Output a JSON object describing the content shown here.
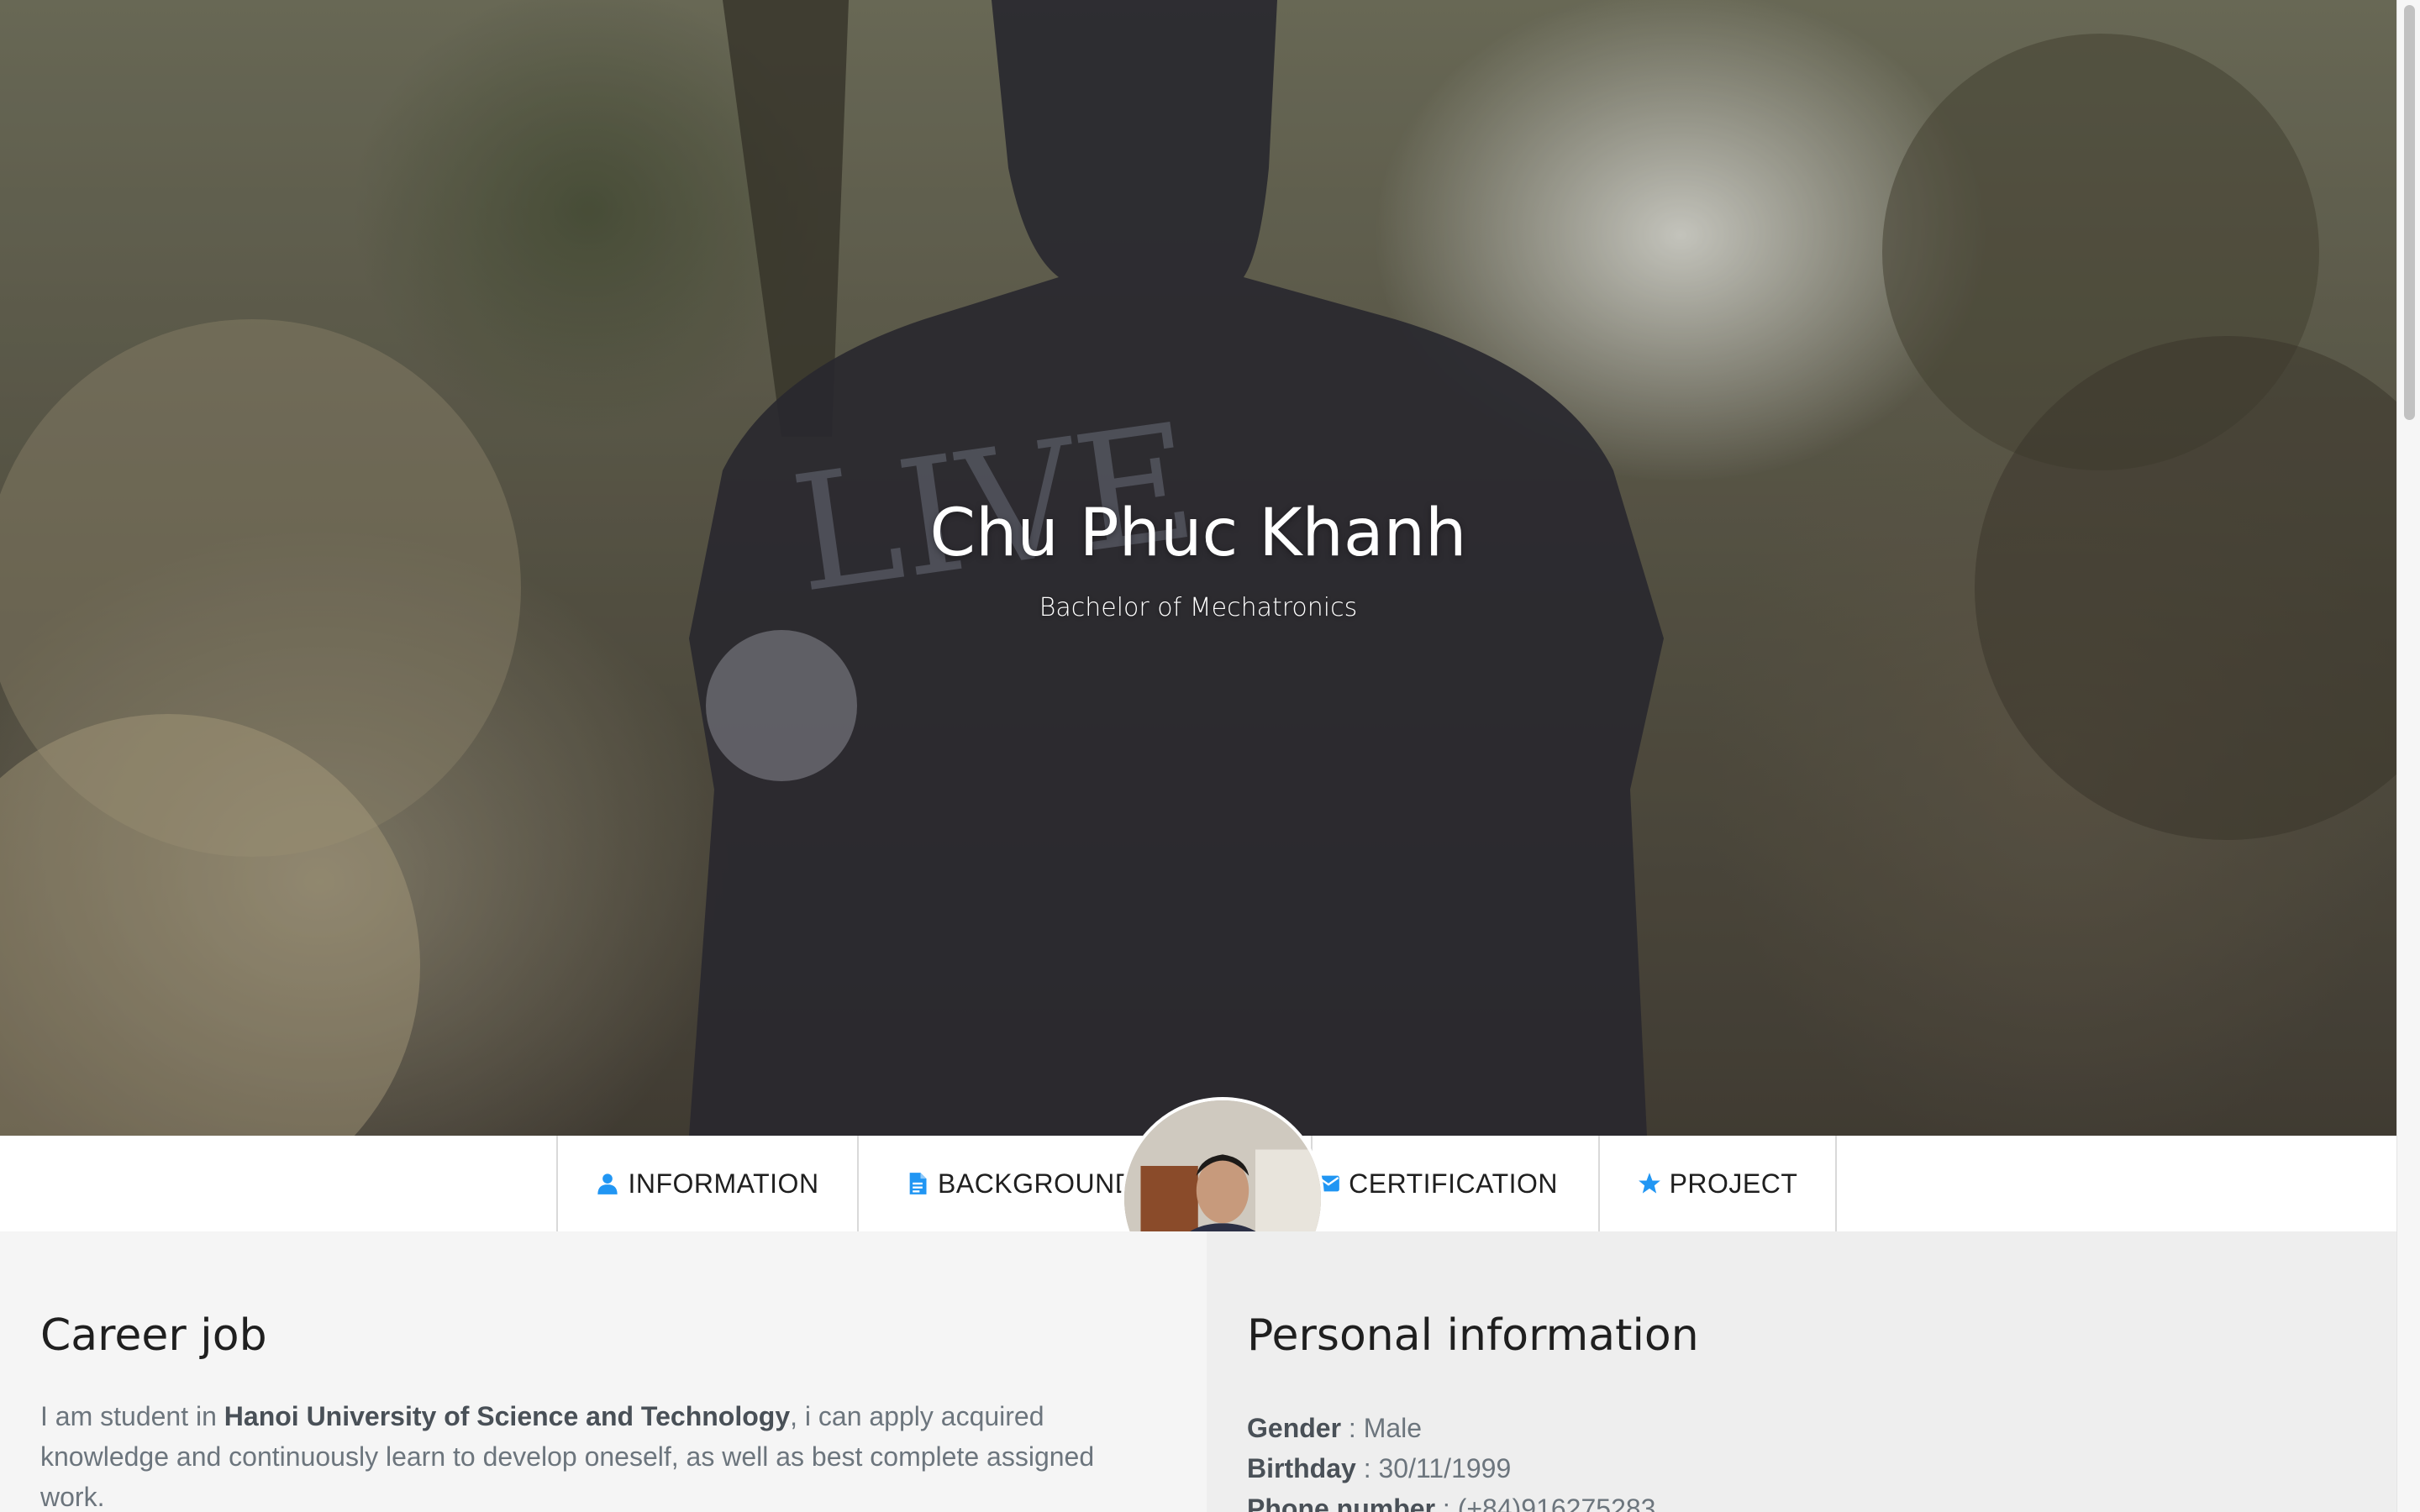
{
  "hero": {
    "name": "Chu Phuc Khanh",
    "subtitle": "Bachelor of Mechatronics"
  },
  "nav": {
    "items": [
      {
        "label": "INFORMATION",
        "icon": "user-icon"
      },
      {
        "label": "BACKGROUND",
        "icon": "document-icon"
      },
      {
        "label": "CERTIFICATION",
        "icon": "envelope-icon"
      },
      {
        "label": "PROJECT",
        "icon": "star-icon"
      }
    ],
    "icon_color": "#2196f3"
  },
  "career": {
    "title": "Career job",
    "text_before": "I am student in ",
    "university": "Hanoi University of Science and Technology",
    "text_after": ", i can apply acquired knowledge and continuously learn to develop oneself, as well as best complete assigned work."
  },
  "personal": {
    "title": "Personal information",
    "fields": [
      {
        "label": "Gender",
        "value": "Male"
      },
      {
        "label": "Birthday",
        "value": "30/11/1999"
      },
      {
        "label": "Phone number",
        "value": "(+84)916275283"
      }
    ]
  }
}
